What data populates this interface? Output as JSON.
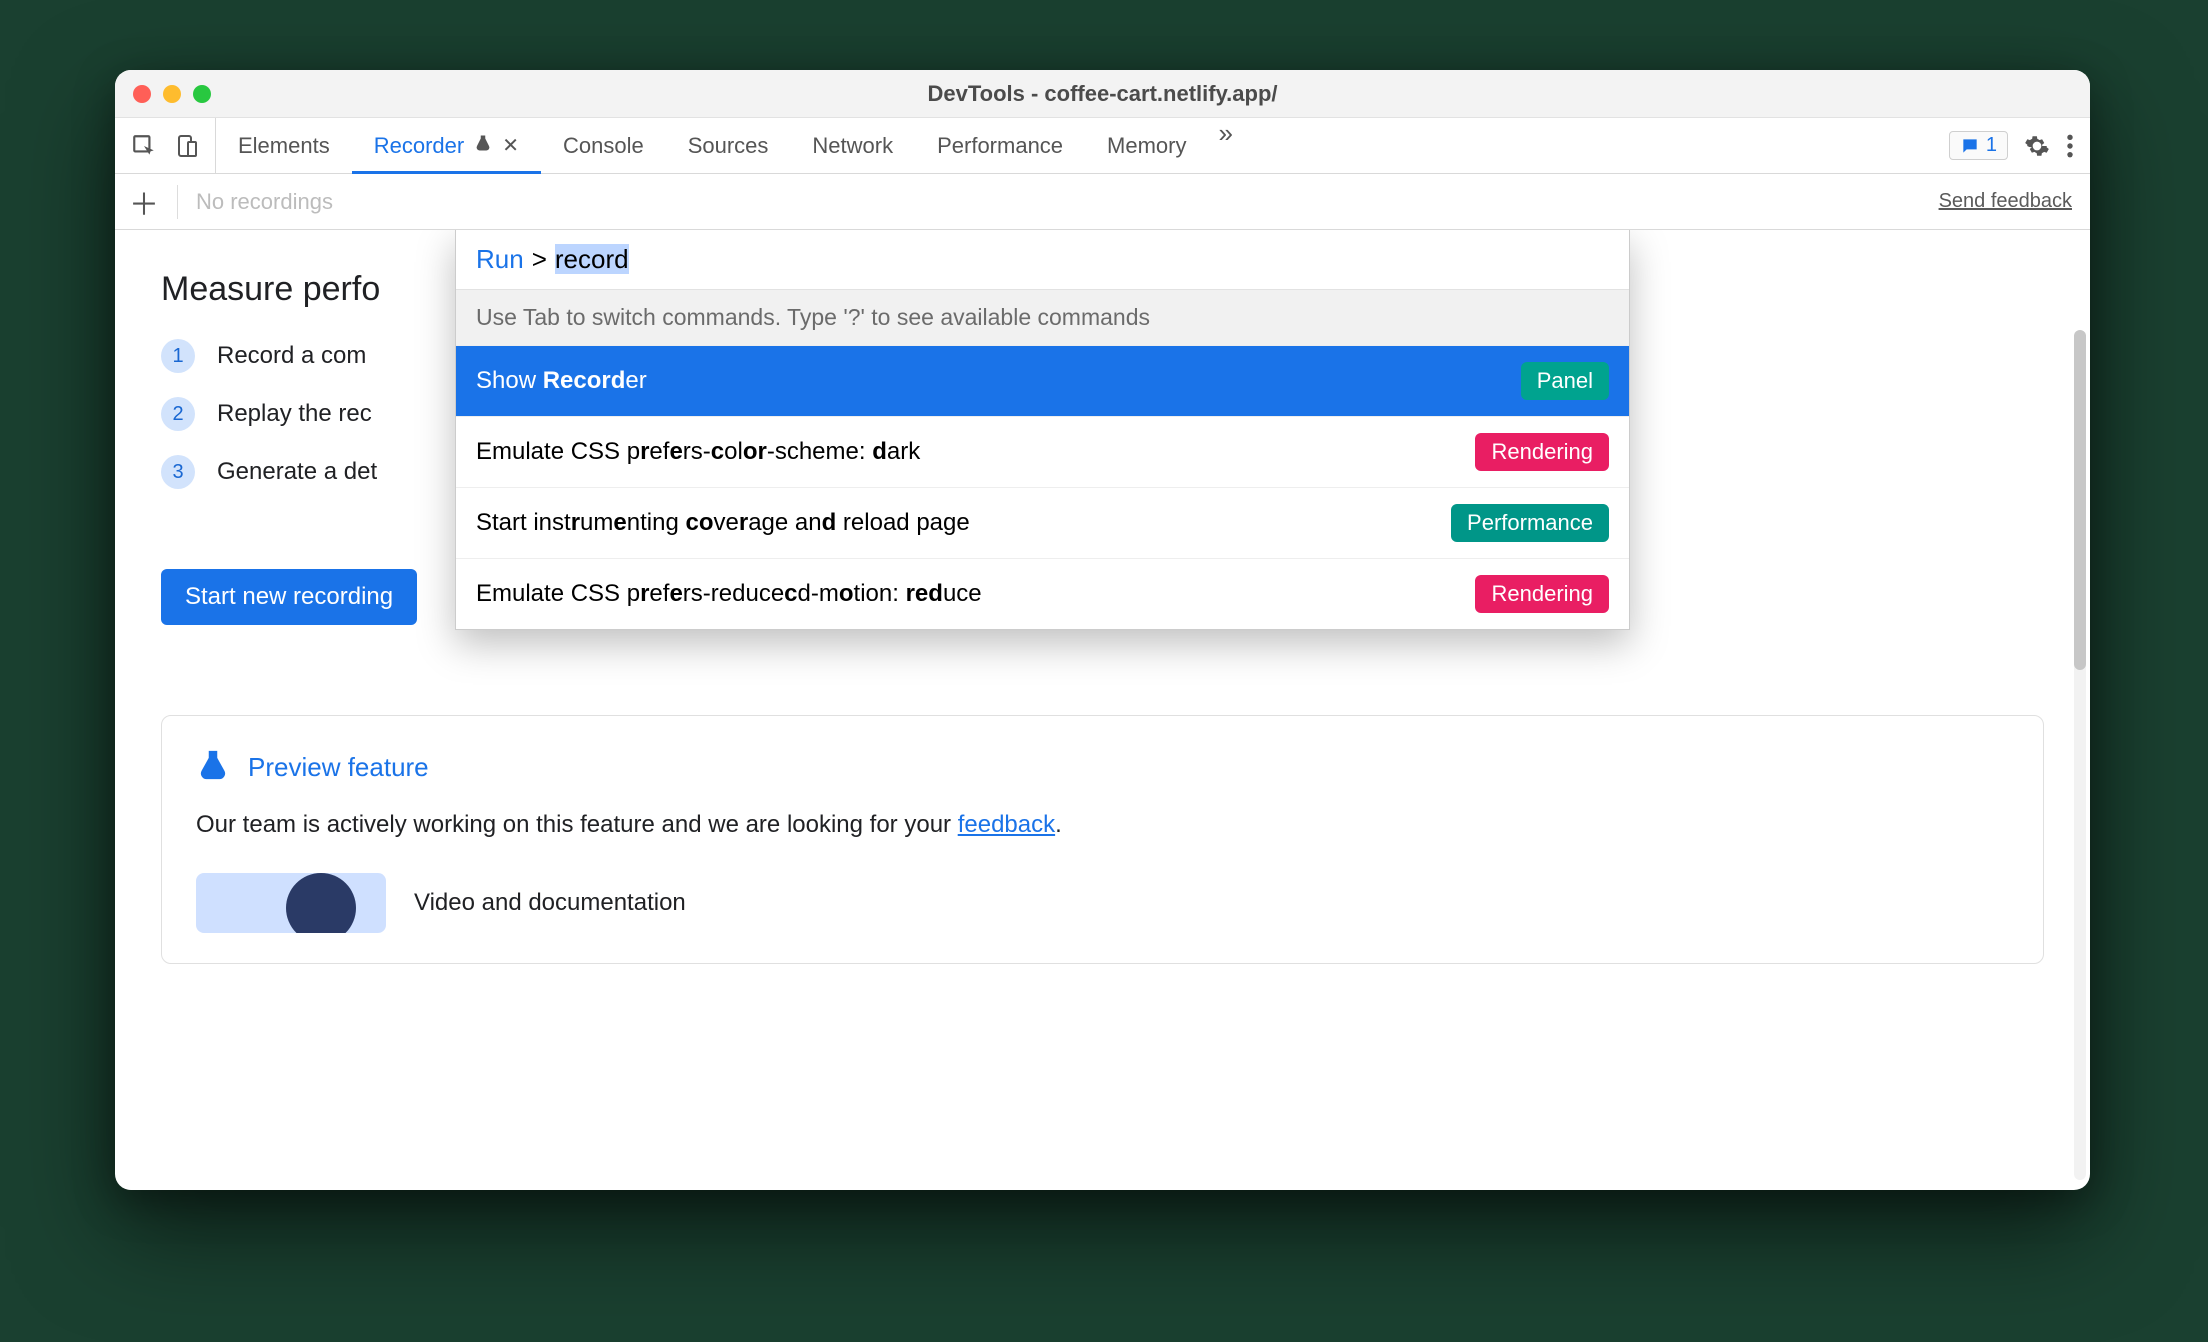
{
  "window": {
    "title": "DevTools - coffee-cart.netlify.app/"
  },
  "tabs": {
    "items": [
      "Elements",
      "Recorder",
      "Console",
      "Sources",
      "Network",
      "Performance",
      "Memory"
    ],
    "active_index": 1
  },
  "toolbar_right": {
    "message_count": "1"
  },
  "subtoolbar": {
    "placeholder": "No recordings",
    "feedback_link": "Send feedback"
  },
  "panel": {
    "heading": "Measure perfo",
    "steps": [
      "Record a com",
      "Replay the rec",
      "Generate a det"
    ],
    "start_button": "Start new recording"
  },
  "preview": {
    "title": "Preview feature",
    "body_prefix": "Our team is actively working on this feature and we are looking for your ",
    "body_link": "feedback",
    "body_suffix": ".",
    "doc_title": "Video and documentation"
  },
  "palette": {
    "prefix": "Run",
    "caret": ">",
    "query": "record",
    "hint": "Use Tab to switch commands. Type '?' to see available commands",
    "items": [
      {
        "label_html": "Show <b>Record</b>er",
        "badge": "Panel",
        "badge_color": "teal",
        "selected": true
      },
      {
        "label_html": "Emulate CSS p<b>r</b>ef<b>e</b>rs-<b>c</b>ol<b>or</b>-scheme: <b>d</b>ark",
        "badge": "Rendering",
        "badge_color": "pink",
        "selected": false
      },
      {
        "label_html": "Start inst<b>r</b>um<b>e</b>nting <b>co</b>ve<b>r</b>age an<b>d</b> reload page",
        "badge": "Performance",
        "badge_color": "green",
        "selected": false
      },
      {
        "label_html": "Emulate CSS p<b>r</b>ef<b>e</b>rs-reduce<b>c</b>d-m<b>o</b>tion: <b>red</b>uce",
        "badge": "Rendering",
        "badge_color": "pink",
        "selected": false
      }
    ]
  }
}
